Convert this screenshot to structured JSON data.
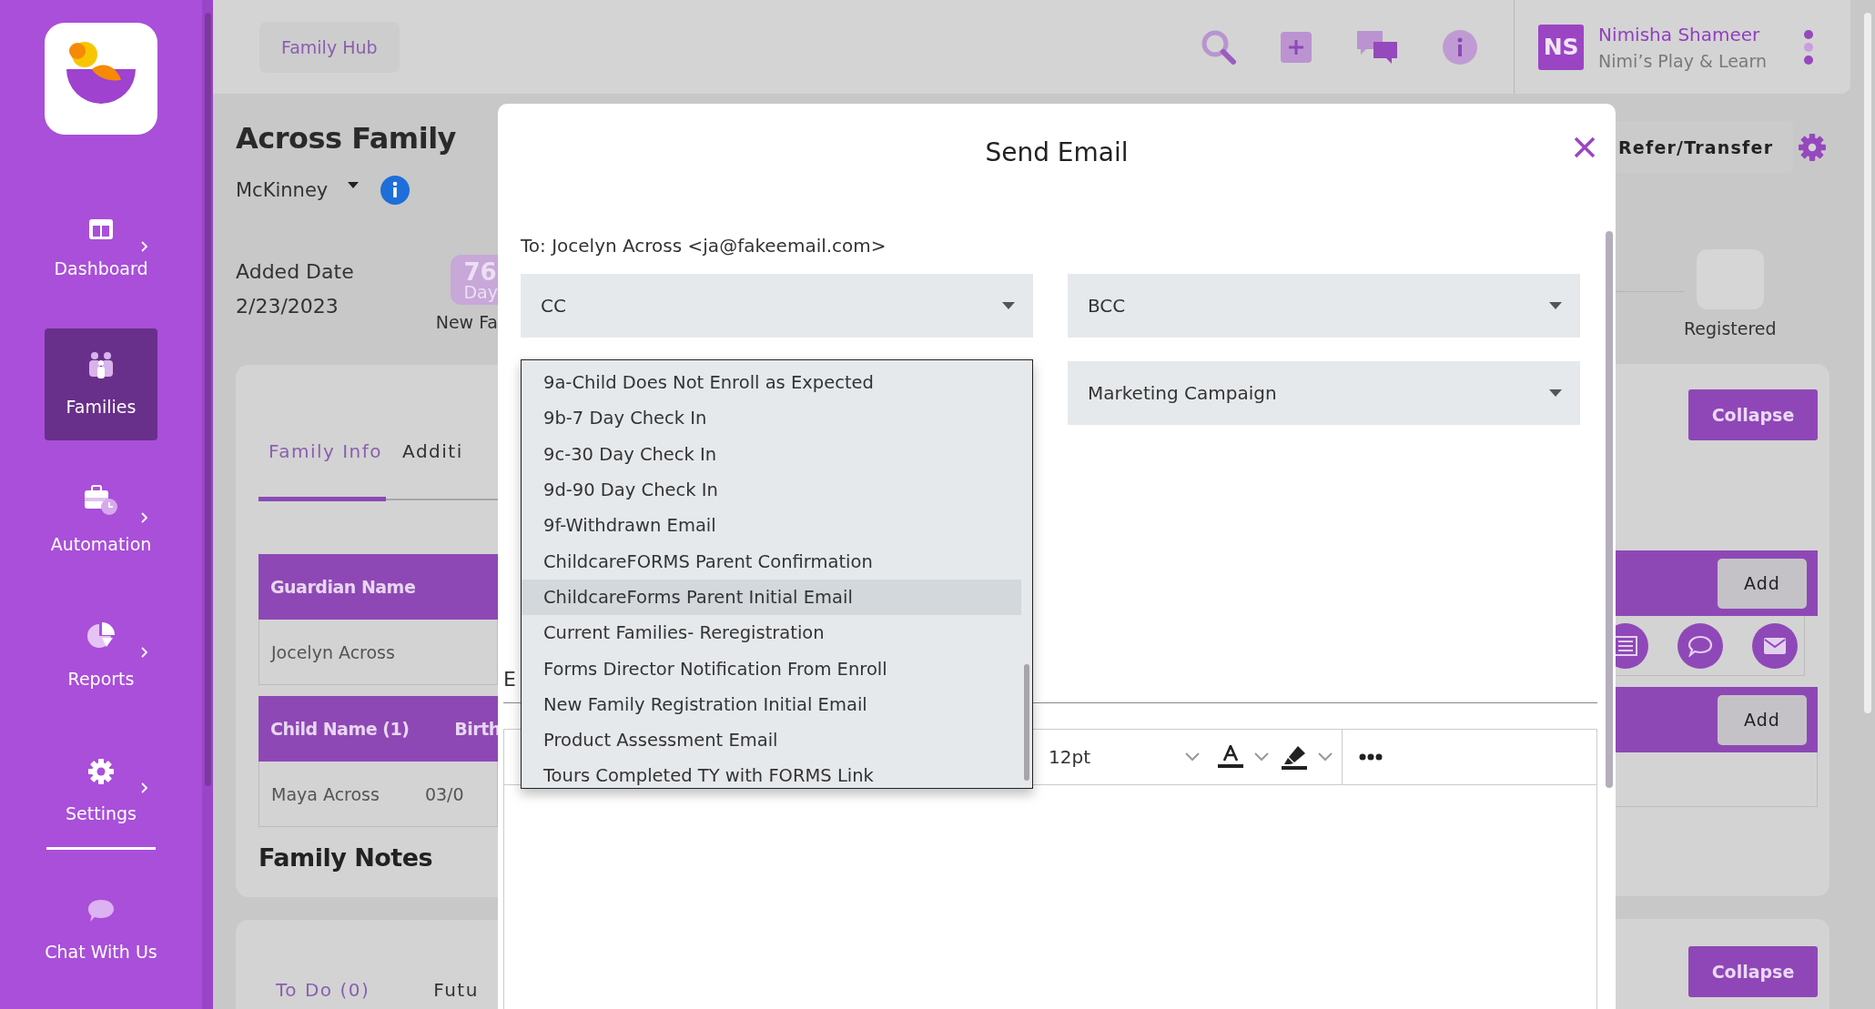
{
  "sidebar": {
    "items": [
      {
        "label": "Dashboard",
        "kind": "dashboard",
        "selected": false,
        "submenu": true
      },
      {
        "label": "Families",
        "kind": "families",
        "selected": true,
        "submenu": false
      },
      {
        "label": "Automation",
        "kind": "automation",
        "selected": false,
        "submenu": true
      },
      {
        "label": "Reports",
        "kind": "reports",
        "selected": false,
        "submenu": true
      },
      {
        "label": "Settings",
        "kind": "settings",
        "selected": false,
        "submenu": true
      },
      {
        "label": "Chat With Us",
        "kind": "chat",
        "selected": false,
        "submenu": false
      }
    ]
  },
  "header": {
    "breadcrumb": "Family Hub",
    "user": {
      "initials": "NS",
      "name": "Nimisha Shameer",
      "organization": "Nimi’s Play & Learn"
    }
  },
  "family": {
    "title": "Across Family",
    "location": "McKinney",
    "added_date_label": "Added Date",
    "added_date": "2/23/2023",
    "days_badge": {
      "count": "76",
      "unit": "Day"
    },
    "stage_label": "New Fa",
    "tabs": [
      {
        "label": "Family Info",
        "selected": true
      },
      {
        "label": "Additi",
        "selected": false
      }
    ],
    "guardian_table": {
      "columns": [
        "Guardian Name"
      ],
      "rows": [
        [
          "Jocelyn Across"
        ]
      ]
    },
    "child_table": {
      "columns": [
        "Child Name (1)",
        "Birth"
      ],
      "rows": [
        [
          "Maya Across",
          "03/0"
        ]
      ]
    },
    "notes_title": "Family Notes",
    "task_tabs": [
      {
        "label": "To Do (0)",
        "selected": true
      },
      {
        "label": "Futu",
        "selected": false
      }
    ]
  },
  "right_panel": {
    "refer_button": "Refer/Transfer",
    "stage": "Registered",
    "collapse_buttons": [
      "Collapse",
      "Collapse"
    ],
    "add_buttons": [
      "Add",
      "Add"
    ]
  },
  "modal": {
    "title": "Send Email",
    "to": "To: Jocelyn Across <ja@fakeemail.com>",
    "cc": {
      "placeholder": "CC"
    },
    "bcc": {
      "placeholder": "BCC"
    },
    "templates": {
      "options": [
        {
          "label": "9a-Child Does Not Enroll as Expected",
          "selected": false
        },
        {
          "label": "9b-7 Day Check In",
          "selected": false
        },
        {
          "label": "9c-30 Day Check In",
          "selected": false
        },
        {
          "label": "9d-90 Day Check In",
          "selected": false
        },
        {
          "label": "9f-Withdrawn Email",
          "selected": false
        },
        {
          "label": "ChildcareFORMS Parent Confirmation",
          "selected": false
        },
        {
          "label": "ChildcareForms Parent Initial Email",
          "selected": true
        },
        {
          "label": "Current Families- Reregistration",
          "selected": false
        },
        {
          "label": "Forms Director Notification From Enroll",
          "selected": false
        },
        {
          "label": "New Family Registration Initial Email",
          "selected": false
        },
        {
          "label": "Product Assessment Email",
          "selected": false
        },
        {
          "label": "Tours Completed TY with FORMS Link",
          "selected": false
        }
      ]
    },
    "campaign": {
      "value": "Marketing Campaign"
    },
    "label_fragment": "E",
    "toolbar": {
      "font_size": "12pt"
    }
  }
}
